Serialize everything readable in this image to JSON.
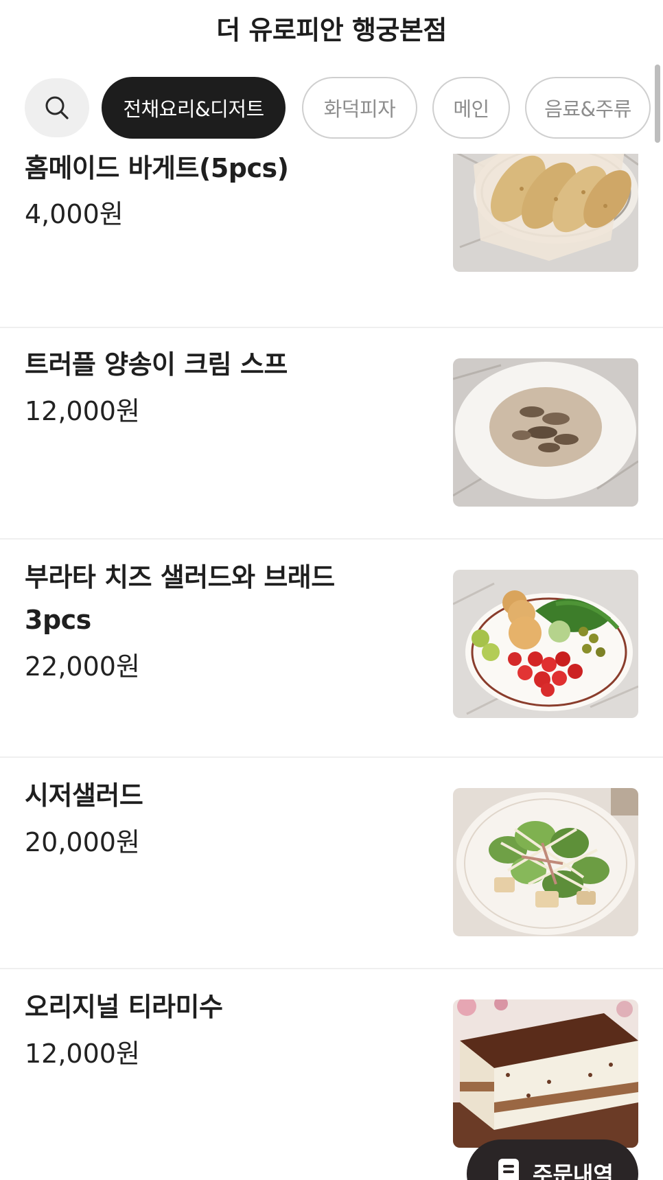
{
  "header": {
    "title": "더 유로피안 행궁본점"
  },
  "categories": {
    "search_icon": "search-icon",
    "chips": [
      {
        "label": "전채요리&디저트",
        "active": true
      },
      {
        "label": "화덕피자",
        "active": false
      },
      {
        "label": "메인",
        "active": false
      },
      {
        "label": "음료&주류",
        "active": false
      }
    ]
  },
  "menu": {
    "items": [
      {
        "name": "홈메이드 바게트(5pcs)",
        "price": "4,000원",
        "image": "baguette-photo"
      },
      {
        "name": "트러플 양송이 크림 스프",
        "price": "12,000원",
        "image": "mushroom-soup-photo"
      },
      {
        "name": "부라타 치즈 샐러드와 브래드 3pcs",
        "price": "22,000원",
        "image": "burrata-salad-photo"
      },
      {
        "name": "시저샐러드",
        "price": "20,000원",
        "image": "caesar-salad-photo"
      },
      {
        "name": "오리지널 티라미수",
        "price": "12,000원",
        "image": "tiramisu-photo"
      }
    ]
  },
  "order_button": {
    "label": "주문내역",
    "icon": "receipt-icon"
  },
  "colors": {
    "active_chip": "#1d1d1d",
    "chip_border": "#cfcfcf",
    "order_button": "#2a2526"
  }
}
